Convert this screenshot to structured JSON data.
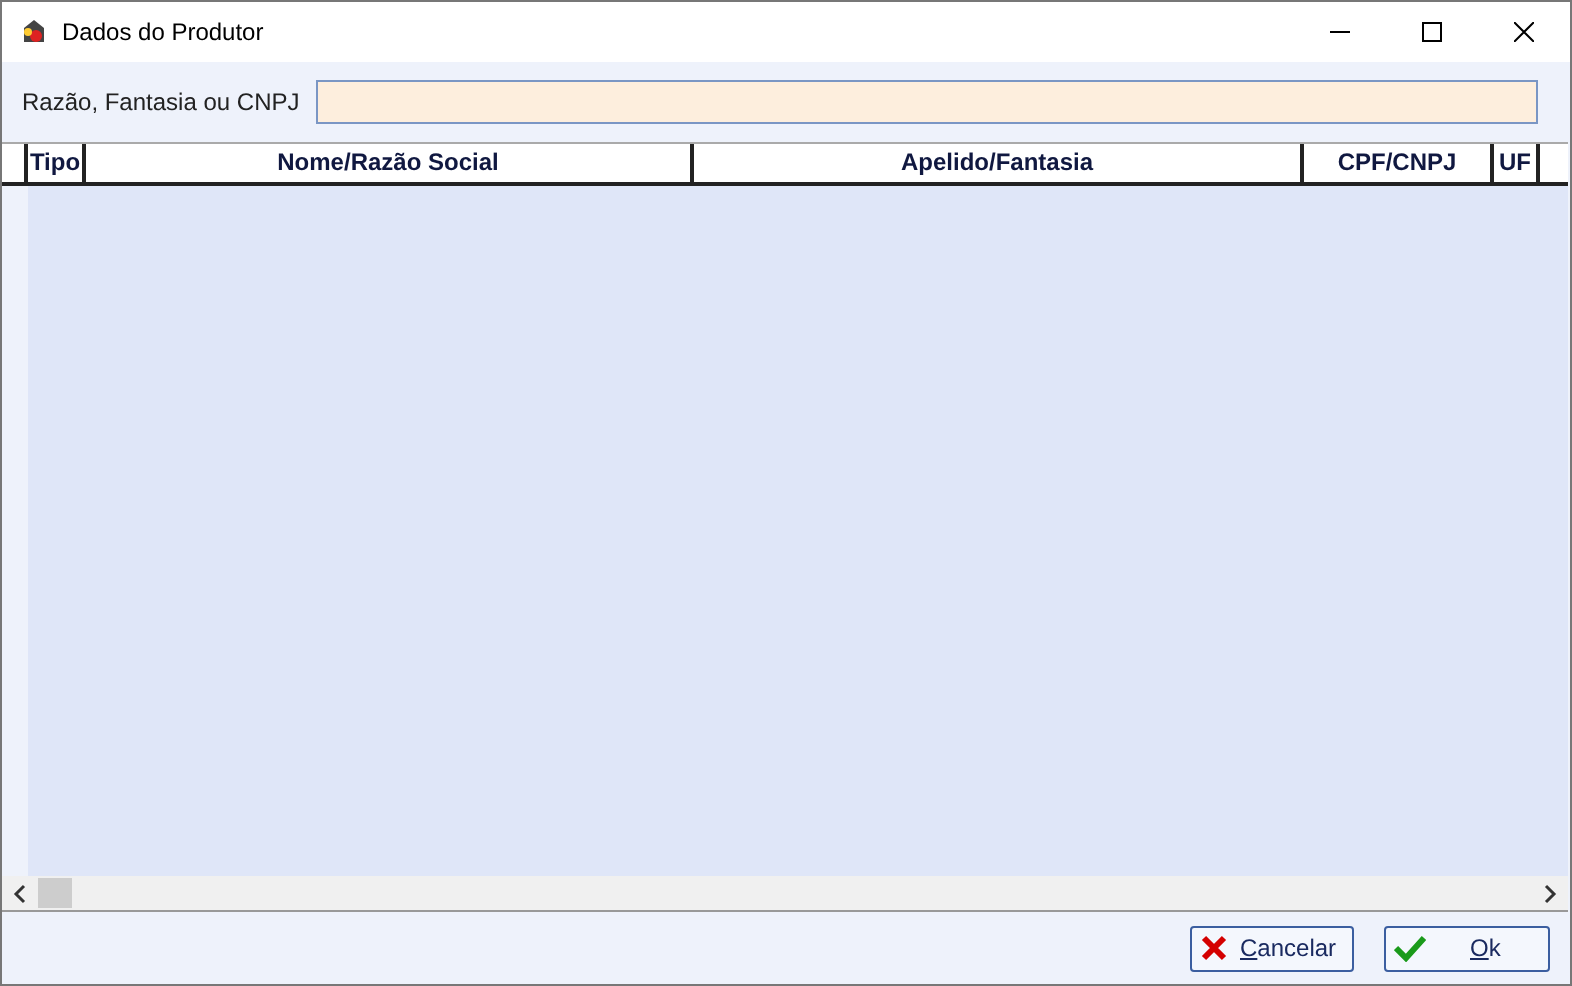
{
  "window": {
    "title": "Dados do Produtor"
  },
  "search": {
    "label": "Razão, Fantasia ou CNPJ"
  },
  "table": {
    "columns": [
      {
        "label": "Tipo"
      },
      {
        "label": "Nome/Razão Social"
      },
      {
        "label": "Apelido/Fantasia"
      },
      {
        "label": "CPF/CNPJ"
      },
      {
        "label": "UF"
      }
    ]
  },
  "buttons": [
    {
      "kind": "cancel",
      "label": "Cancelar"
    },
    {
      "kind": "ok",
      "label": "Ok"
    }
  ]
}
